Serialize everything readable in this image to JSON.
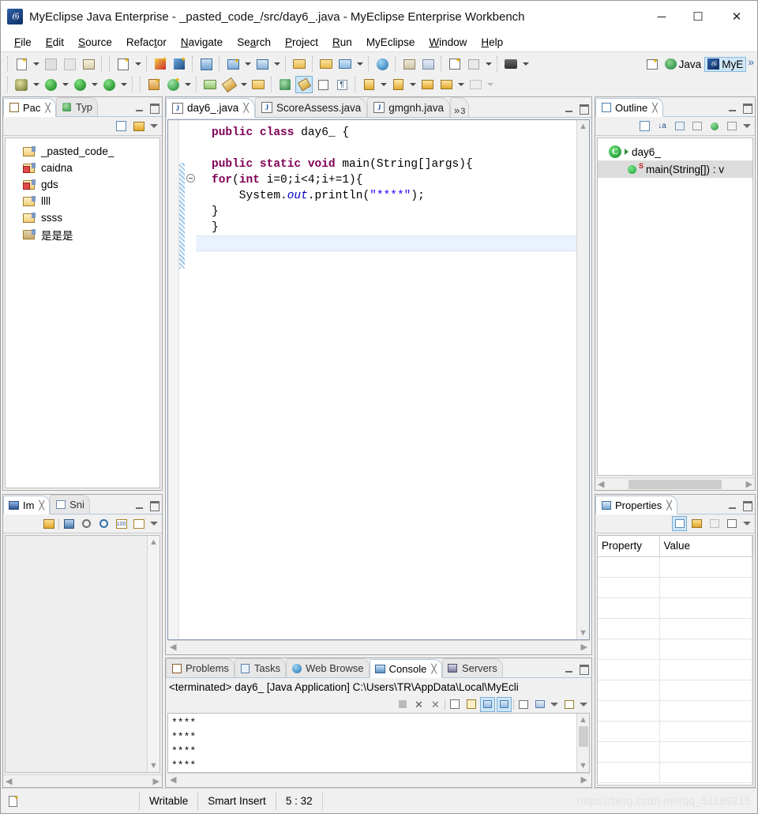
{
  "window": {
    "title": "MyEclipse Java Enterprise - _pasted_code_/src/day6_.java - MyEclipse Enterprise Workbench",
    "app_icon": "myeclipse-logo-icon",
    "minimize": "─",
    "maximize": "☐",
    "close": "✕"
  },
  "menubar": {
    "items": [
      {
        "label": "File",
        "mnemonic": "F"
      },
      {
        "label": "Edit",
        "mnemonic": "E"
      },
      {
        "label": "Source",
        "mnemonic": "S"
      },
      {
        "label": "Refactor",
        "mnemonic": "t"
      },
      {
        "label": "Navigate",
        "mnemonic": "N"
      },
      {
        "label": "Search",
        "mnemonic": "a"
      },
      {
        "label": "Project",
        "mnemonic": "P"
      },
      {
        "label": "Run",
        "mnemonic": "R"
      },
      {
        "label": "MyEclipse",
        "mnemonic": ""
      },
      {
        "label": "Window",
        "mnemonic": "W"
      },
      {
        "label": "Help",
        "mnemonic": "H"
      }
    ]
  },
  "perspective_bar": {
    "open_perspective_icon": "open-perspective-icon",
    "items": [
      {
        "label": "Java",
        "icon": "java-perspective-icon",
        "selected": false
      },
      {
        "label": "MyE",
        "icon": "myeclipse-perspective-icon",
        "selected": true
      }
    ],
    "overflow": "»"
  },
  "package_explorer": {
    "tabs": [
      {
        "label": "Pac",
        "icon": "package-explorer-icon",
        "active": true,
        "closeable": true
      },
      {
        "label": "Typ",
        "icon": "type-hierarchy-icon",
        "active": false,
        "closeable": false
      }
    ],
    "toolbar": [
      {
        "icon": "collapse-all-icon"
      },
      {
        "icon": "link-with-editor-icon"
      },
      {
        "icon": "view-menu-icon"
      }
    ],
    "projects": [
      {
        "label": "_pasted_code_",
        "icon": "java-project-icon",
        "state": "normal"
      },
      {
        "label": "caidna",
        "icon": "java-project-icon",
        "state": "error"
      },
      {
        "label": "gds",
        "icon": "java-project-icon",
        "state": "error"
      },
      {
        "label": "llll",
        "icon": "java-project-icon",
        "state": "normal"
      },
      {
        "label": "ssss",
        "icon": "java-project-icon",
        "state": "normal"
      },
      {
        "label": "是是是",
        "icon": "web-project-icon",
        "state": "warning"
      }
    ]
  },
  "image_view": {
    "tabs": [
      {
        "label": "Im",
        "icon": "image-viewer-icon",
        "active": true,
        "closeable": true
      },
      {
        "label": "Sni",
        "icon": "snippets-icon",
        "active": false,
        "closeable": false
      }
    ],
    "toolbar": [
      {
        "icon": "link-with-editor-icon"
      },
      {
        "icon": "open-image-icon"
      },
      {
        "icon": "zoom-out-icon"
      },
      {
        "icon": "zoom-in-icon"
      },
      {
        "icon": "zoom-100-icon"
      },
      {
        "icon": "fit-to-window-icon"
      },
      {
        "icon": "view-menu-icon"
      }
    ]
  },
  "editor": {
    "tabs": [
      {
        "label": "day6_.java",
        "icon": "java-file-icon",
        "active": true,
        "closeable": true
      },
      {
        "label": "ScoreAssess.java",
        "icon": "java-file-icon",
        "active": false,
        "closeable": false
      },
      {
        "label": "gmgnh.java",
        "icon": "java-file-icon",
        "active": false,
        "closeable": false
      }
    ],
    "overflow_chevron": "»",
    "overflow_count": "3",
    "code_lines": [
      [
        {
          "t": "public class ",
          "c": "kw"
        },
        {
          "t": "day6_ {",
          "c": ""
        }
      ],
      [
        {
          "t": "",
          "c": ""
        }
      ],
      [
        {
          "t": "public static void ",
          "c": "kw"
        },
        {
          "t": "main(String[]args){",
          "c": ""
        }
      ],
      [
        {
          "t": "for",
          "c": "kw"
        },
        {
          "t": "(",
          "c": ""
        },
        {
          "t": "int",
          "c": "kw"
        },
        {
          "t": " i=0;i<4;i+=1){",
          "c": ""
        }
      ],
      [
        {
          "t": "    System.",
          "c": ""
        },
        {
          "t": "out",
          "c": "fld"
        },
        {
          "t": ".println(",
          "c": ""
        },
        {
          "t": "\"****\"",
          "c": "str"
        },
        {
          "t": ");",
          "c": ""
        }
      ],
      [
        {
          "t": "}",
          "c": ""
        }
      ],
      [
        {
          "t": "}",
          "c": ""
        }
      ],
      [
        {
          "t": "}",
          "c": ""
        }
      ]
    ]
  },
  "bottom_panel": {
    "tabs": [
      {
        "label": "Problems",
        "icon": "problems-icon",
        "active": false,
        "closeable": false
      },
      {
        "label": "Tasks",
        "icon": "tasks-icon",
        "active": false,
        "closeable": false
      },
      {
        "label": "Web Browse",
        "icon": "web-browser-icon",
        "active": false,
        "closeable": false
      },
      {
        "label": "Console",
        "icon": "console-icon",
        "active": true,
        "closeable": true
      },
      {
        "label": "Servers",
        "icon": "servers-icon",
        "active": false,
        "closeable": false
      }
    ],
    "console_description": "<terminated> day6_ [Java Application] C:\\Users\\TR\\AppData\\Local\\MyEcli",
    "console_toolbar": [
      {
        "icon": "terminate-icon",
        "state": "disabled"
      },
      {
        "icon": "remove-launch-icon",
        "state": "enabled"
      },
      {
        "icon": "remove-all-terminated-icon",
        "state": "enabled"
      },
      {
        "icon": "clear-console-icon",
        "state": "enabled"
      },
      {
        "icon": "scroll-lock-icon",
        "state": "enabled"
      },
      {
        "icon": "show-console-on-output-icon",
        "state": "pressed"
      },
      {
        "icon": "show-console-on-error-icon",
        "state": "pressed"
      },
      {
        "icon": "pin-console-icon",
        "state": "enabled"
      },
      {
        "icon": "display-selected-console-icon",
        "state": "enabled"
      },
      {
        "icon": "open-console-icon",
        "state": "enabled"
      }
    ],
    "console_output": [
      "****",
      "****",
      "****",
      "****"
    ]
  },
  "outline": {
    "tabs": [
      {
        "label": "Outline",
        "icon": "outline-icon",
        "active": true,
        "closeable": true
      }
    ],
    "toolbar": [
      {
        "icon": "collapse-all-icon"
      },
      {
        "icon": "sort-alphabetically-icon"
      },
      {
        "icon": "hide-fields-icon"
      },
      {
        "icon": "hide-static-icon"
      },
      {
        "icon": "hide-non-public-icon"
      },
      {
        "icon": "hide-local-types-icon"
      },
      {
        "icon": "view-menu-icon"
      }
    ],
    "nodes": [
      {
        "label": "day6_",
        "icon": "class-icon",
        "level": 1,
        "selected": false
      },
      {
        "label": "main(String[]) : v",
        "icon": "method-public-static-icon",
        "level": 2,
        "selected": true
      }
    ]
  },
  "properties": {
    "tabs": [
      {
        "label": "Properties",
        "icon": "properties-icon",
        "active": true,
        "closeable": true
      }
    ],
    "toolbar": [
      {
        "icon": "show-categories-icon",
        "state": "pressed"
      },
      {
        "icon": "show-advanced-icon",
        "state": "enabled"
      },
      {
        "icon": "restore-default-icon",
        "state": "disabled"
      },
      {
        "icon": "new-properties-view-icon",
        "state": "enabled"
      },
      {
        "icon": "view-menu-icon",
        "state": "enabled"
      }
    ],
    "columns": [
      "Property",
      "Value"
    ],
    "rows": []
  },
  "statusbar": {
    "icon": "editor-state-icon",
    "writable": "Writable",
    "insert_mode": "Smart Insert",
    "cursor_position": "5 : 32",
    "watermark": "https://blog.csdn.net/qq_51189215"
  },
  "colors": {
    "accent": "#cde6f7",
    "keyword": "#7f0055",
    "string": "#2a00ff",
    "field": "#0000c0",
    "tab_border": "#b5c6d8"
  }
}
